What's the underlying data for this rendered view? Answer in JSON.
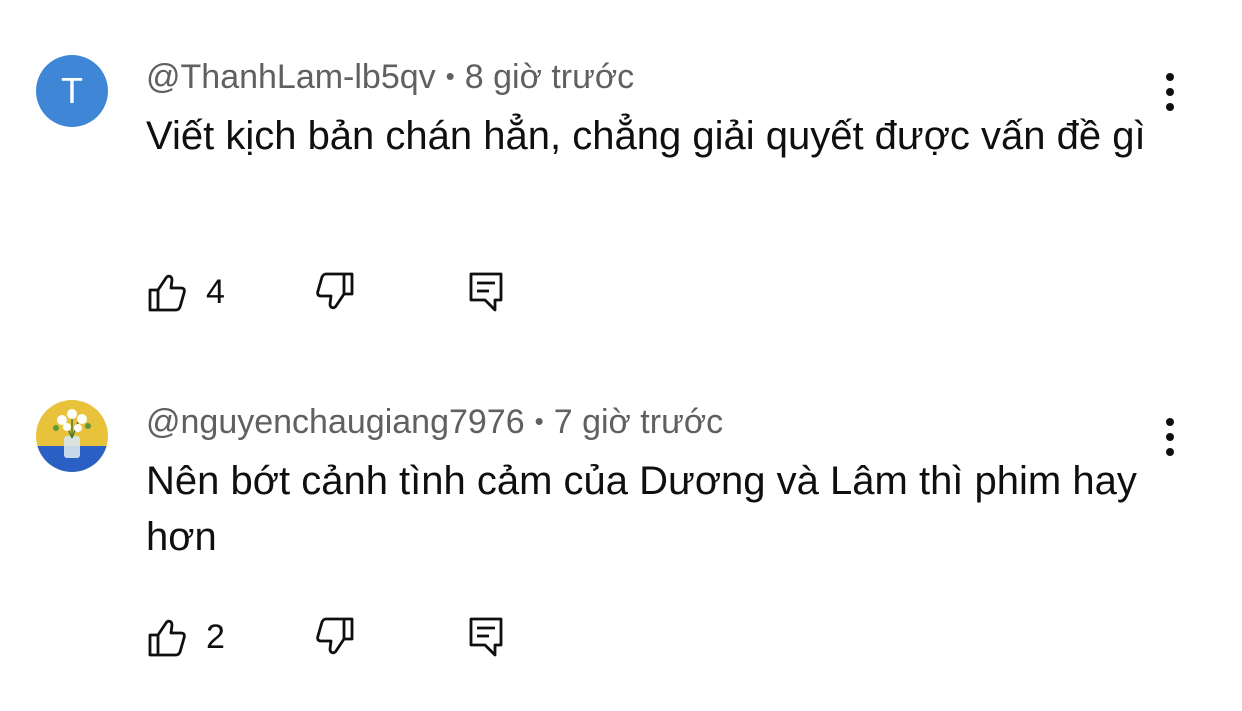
{
  "comments": [
    {
      "avatar_letter": "T",
      "author": "@ThanhLam-lb5qv",
      "separator": "•",
      "time": "8 giờ trước",
      "text": "Viết kịch bản chán hẳn, chẳng giải quyết được vấn đề gì",
      "likes": "4"
    },
    {
      "author": "@nguyenchaugiang7976",
      "separator": "•",
      "time": "7 giờ trước",
      "text": "Nên bớt cảnh tình cảm của Dương và Lâm thì phim hay hơn",
      "likes": "2"
    }
  ],
  "icons": {
    "like": "thumbs-up-icon",
    "dislike": "thumbs-down-icon",
    "reply": "reply-comment-icon",
    "more": "more-vertical-icon"
  },
  "colors": {
    "avatar_bg": "#3f86d6",
    "meta_text": "#606060",
    "body_text": "#0f0f0f"
  }
}
